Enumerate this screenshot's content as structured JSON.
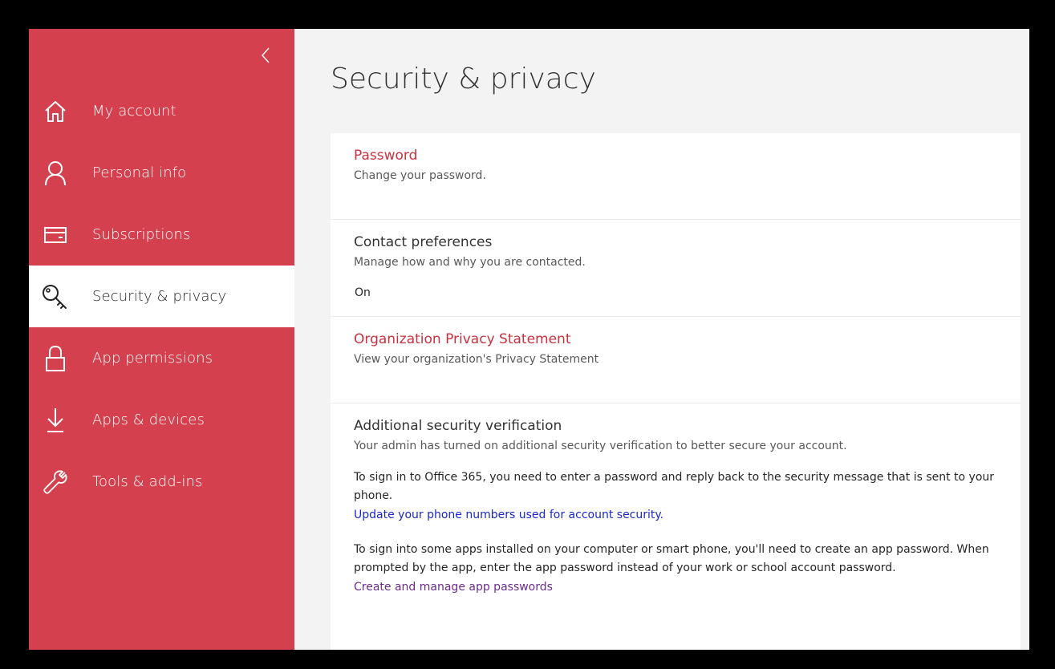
{
  "sidebar": {
    "collapse_icon": "chevron-left-icon",
    "items": [
      {
        "label": "My account",
        "icon": "home-icon",
        "active": false
      },
      {
        "label": "Personal info",
        "icon": "person-icon",
        "active": false
      },
      {
        "label": "Subscriptions",
        "icon": "card-icon",
        "active": false
      },
      {
        "label": "Security & privacy",
        "icon": "key-icon",
        "active": true
      },
      {
        "label": "App permissions",
        "icon": "lock-icon",
        "active": false
      },
      {
        "label": "Apps & devices",
        "icon": "download-icon",
        "active": false
      },
      {
        "label": "Tools & add-ins",
        "icon": "wrench-icon",
        "active": false
      }
    ]
  },
  "main": {
    "title": "Security & privacy",
    "password": {
      "title": "Password",
      "desc": "Change your password."
    },
    "contact": {
      "title": "Contact preferences",
      "desc": "Manage how and why you are contacted.",
      "state": "On"
    },
    "org_privacy": {
      "title": "Organization Privacy Statement",
      "desc": "View your organization's Privacy Statement"
    },
    "additional": {
      "title": "Additional security verification",
      "desc": "Your admin has turned on additional security verification to better secure your account.",
      "para1": "To sign in to Office 365, you need to enter a password and reply back to the security message that is sent to your phone.",
      "link1": "Update your phone numbers used for account security.",
      "para2": "To sign into some apps installed on your computer or smart phone, you'll need to create an app password. When prompted by the app, enter the app password instead of your work or school account password.",
      "link2": "Create and manage app passwords"
    }
  },
  "colors": {
    "accent": "#d4404e",
    "link_red": "#c8323f",
    "link_blue": "#1a28c8",
    "link_purple": "#6b2c8c"
  }
}
